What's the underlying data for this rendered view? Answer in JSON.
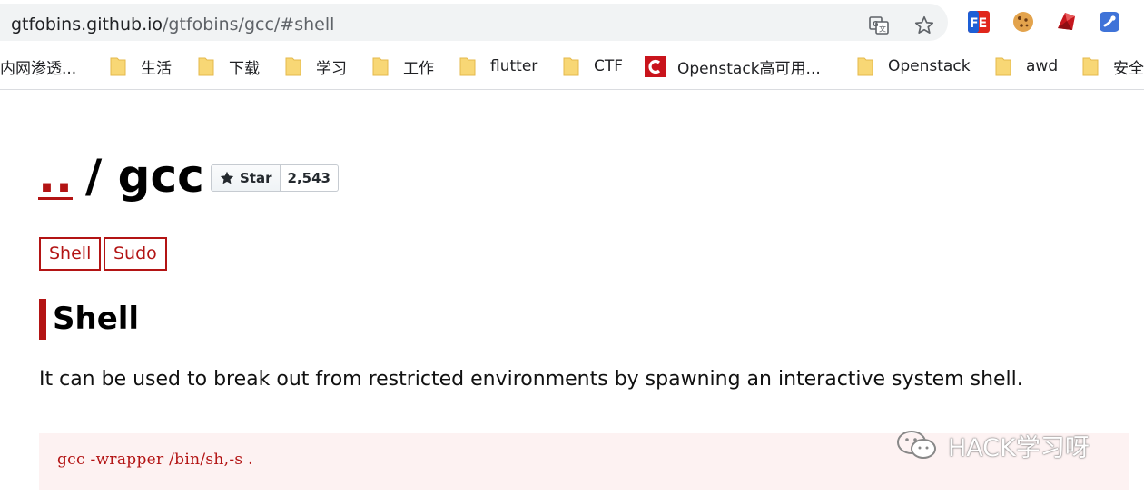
{
  "browser": {
    "url_host": "gtfobins.github.io",
    "url_path": "/gtfobins/gcc/#shell"
  },
  "extensions": [
    {
      "name": "fe-extension-icon",
      "label": "FE",
      "color": "#e0261b"
    },
    {
      "name": "cookie-extension-icon",
      "color": "#e3a34c"
    },
    {
      "name": "ruby-extension-icon",
      "color": "#c5161d"
    },
    {
      "name": "blue-extension-icon",
      "color": "#3f73d8"
    }
  ],
  "bookmarks": [
    {
      "label": "内网渗透..."
    },
    {
      "label": "生活"
    },
    {
      "label": "下载"
    },
    {
      "label": "学习"
    },
    {
      "label": "工作"
    },
    {
      "label": "flutter"
    },
    {
      "label": "CTF"
    },
    {
      "label": "Openstack高可用..."
    },
    {
      "label": "Openstack"
    },
    {
      "label": "awd"
    },
    {
      "label": "安全"
    }
  ],
  "page": {
    "breadcrumb_up": "..",
    "breadcrumb_rest": "/ gcc",
    "star_label": "Star",
    "star_count": "2,543",
    "tags": [
      "Shell",
      "Sudo"
    ],
    "section_title": "Shell",
    "section_desc": "It can be used to break out from restricted environments by spawning an interactive system shell.",
    "code": "gcc -wrapper /bin/sh,-s ."
  },
  "watermark": "HACK学习呀",
  "colors": {
    "accent": "#b31414",
    "code_bg": "#fdf2f2",
    "omnibox_bg": "#f1f3f4"
  }
}
